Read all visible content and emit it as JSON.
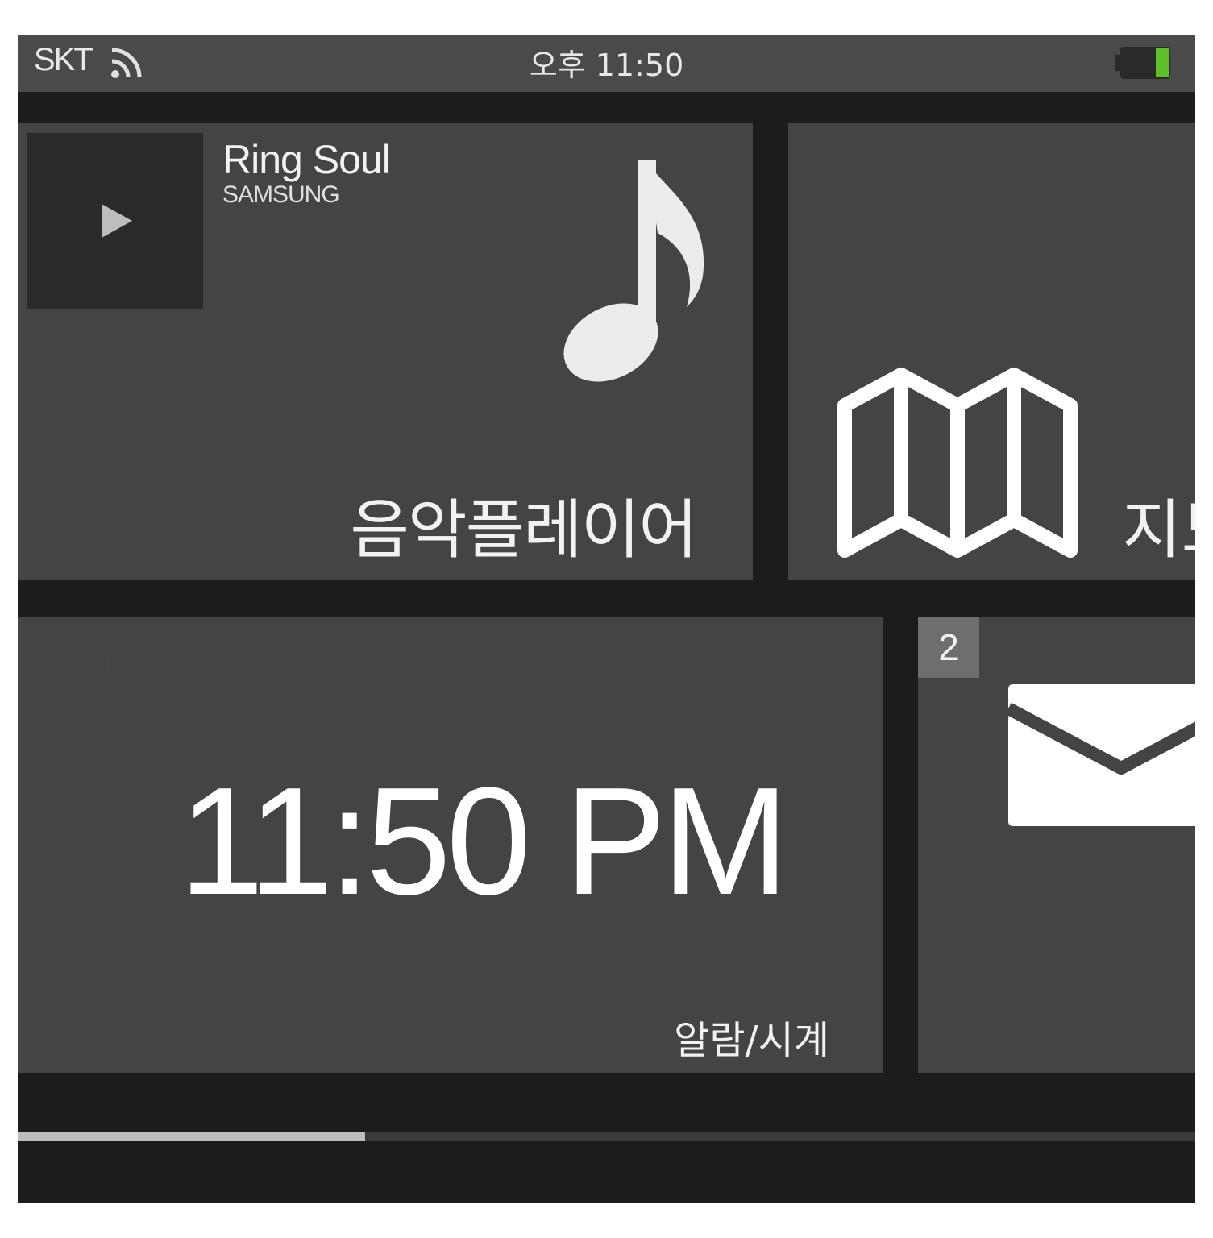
{
  "status_bar": {
    "carrier": "SKT",
    "time": "오후 11:50",
    "battery_color": "#5fbf2a"
  },
  "tiles": {
    "music": {
      "song_title": "Ring Soul",
      "artist": "SAMSUNG",
      "label": "음악플레이어",
      "icon": "music-note-icon"
    },
    "maps": {
      "label": "지도",
      "icon": "map-icon"
    },
    "clock": {
      "time_digits": "11:50",
      "am_pm": "PM",
      "label": "알람/시계",
      "icon": "moon-icon"
    },
    "mail": {
      "badge_count": "2",
      "icon": "envelope-icon"
    }
  },
  "page_indicator": {
    "progress": 0.295
  },
  "colors": {
    "tile_bg": "#444444",
    "screen_bg": "#1c1c1c",
    "status_bg": "#4a4a4a"
  }
}
